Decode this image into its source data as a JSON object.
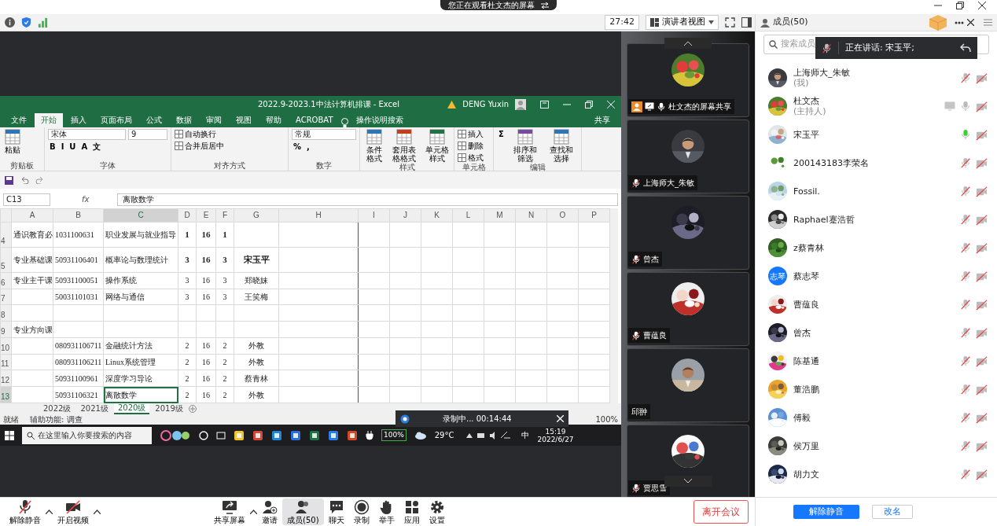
{
  "banner": {
    "text": "您正在观看杜文杰的屏幕"
  },
  "toolbar": {
    "timer": "27:42",
    "view": "演讲者视图"
  },
  "shared_screen": {
    "excel": {
      "title": "2022.9-2023.1中法计算机排课  -  Excel",
      "user": "DENG Yuxin",
      "tabs": [
        {
          "label": "文件",
          "selected": false
        },
        {
          "label": "开始",
          "selected": true
        },
        {
          "label": "插入",
          "selected": false
        },
        {
          "label": "页面布局",
          "selected": false
        },
        {
          "label": "公式",
          "selected": false
        },
        {
          "label": "数据",
          "selected": false
        },
        {
          "label": "审阅",
          "selected": false
        },
        {
          "label": "视图",
          "selected": false
        },
        {
          "label": "帮助",
          "selected": false
        },
        {
          "label": "ACROBAT",
          "selected": false
        }
      ],
      "tell_me": "操作说明搜索",
      "share": "共享",
      "ribbon": [
        {
          "label": "剪贴板",
          "items": [
            {
              "kind": "big",
              "label": "粘贴"
            }
          ]
        },
        {
          "label": "字体",
          "items": [
            {
              "kind": "stack",
              "lines": [
                [
                  {
                    "kind": "field",
                    "value": "宋体"
                  },
                  {
                    "kind": "field",
                    "value": "9"
                  }
                ],
                [
                  {
                    "kind": "glyph",
                    "label": "B"
                  },
                  {
                    "kind": "glyph",
                    "label": "I"
                  },
                  {
                    "kind": "glyph",
                    "label": "U"
                  },
                  {
                    "kind": "glyph",
                    "label": "A"
                  },
                  {
                    "kind": "glyph",
                    "label": "文"
                  }
                ]
              ]
            }
          ]
        },
        {
          "label": "对齐方式",
          "items": [
            {
              "kind": "stack",
              "lines": [
                [
                  {
                    "kind": "small",
                    "label": "自动换行"
                  }
                ],
                [
                  {
                    "kind": "small",
                    "label": "合并后居中"
                  }
                ]
              ]
            }
          ]
        },
        {
          "label": "数字",
          "items": [
            {
              "kind": "stack",
              "lines": [
                [
                  {
                    "kind": "field",
                    "value": "常规"
                  }
                ],
                [
                  {
                    "kind": "glyph",
                    "label": "%"
                  },
                  {
                    "kind": "glyph",
                    "label": ","
                  }
                ]
              ]
            }
          ]
        },
        {
          "label": "样式",
          "items": [
            {
              "kind": "big",
              "label": "条件格式"
            },
            {
              "kind": "big",
              "label": "套用表格格式"
            },
            {
              "kind": "big",
              "label": "单元格样式"
            }
          ]
        },
        {
          "label": "单元格",
          "items": [
            {
              "kind": "stack",
              "lines": [
                [
                  {
                    "kind": "small",
                    "label": "插入"
                  }
                ],
                [
                  {
                    "kind": "small",
                    "label": "删除"
                  }
                ],
                [
                  {
                    "kind": "small",
                    "label": "格式"
                  }
                ]
              ]
            }
          ]
        },
        {
          "label": "编辑",
          "items": [
            {
              "kind": "stack",
              "lines": [
                [
                  {
                    "kind": "glyph",
                    "label": "Σ"
                  }
                ]
              ]
            },
            {
              "kind": "big",
              "label": "排序和筛选"
            },
            {
              "kind": "big",
              "label": "查找和选择"
            }
          ]
        }
      ],
      "name_box": "C13",
      "fx": "fx",
      "formula": "离散数学",
      "columns": [
        {
          "label": "A",
          "selected": false
        },
        {
          "label": "B",
          "selected": false
        },
        {
          "label": "C",
          "selected": true
        },
        {
          "label": "D",
          "selected": false
        },
        {
          "label": "E",
          "selected": false
        },
        {
          "label": "F",
          "selected": false
        },
        {
          "label": "G",
          "selected": false
        },
        {
          "label": "H",
          "selected": false
        },
        {
          "label": "I",
          "selected": false
        },
        {
          "label": "J",
          "selected": false
        },
        {
          "label": "K",
          "selected": false
        },
        {
          "label": "L",
          "selected": false
        },
        {
          "label": "M",
          "selected": false
        },
        {
          "label": "N",
          "selected": false
        },
        {
          "label": "O",
          "selected": false
        },
        {
          "label": "P",
          "selected": false
        }
      ],
      "rows": [
        {
          "number": "4",
          "bold": true,
          "selected": false,
          "cells": [
            "通识教育必",
            "1031100631",
            "职业发展与就业指导",
            "1",
            "16",
            "1",
            "",
            ""
          ]
        },
        {
          "number": "5",
          "bold": true,
          "selected": false,
          "cells": [
            "专业基础课",
            "50931106401",
            "概率论与数理统计",
            "3",
            "16",
            "3",
            "宋玉平",
            ""
          ]
        },
        {
          "number": "6",
          "bold": false,
          "selected": false,
          "cells": [
            "专业主干课",
            "50931100051",
            "操作系统",
            "3",
            "16",
            "3",
            "郑晓妹",
            ""
          ]
        },
        {
          "number": "7",
          "bold": false,
          "selected": false,
          "cells": [
            "",
            "50031101031",
            "网络与通信",
            "3",
            "16",
            "3",
            "王笑梅",
            ""
          ]
        },
        {
          "number": "8",
          "bold": false,
          "selected": false,
          "cells": [
            "",
            "",
            "",
            "",
            "",
            "",
            "",
            ""
          ]
        },
        {
          "number": "9",
          "bold": false,
          "selected": false,
          "cells": [
            "专业方向课",
            "",
            "",
            "",
            "",
            "",
            "",
            ""
          ]
        },
        {
          "number": "10",
          "bold": false,
          "selected": false,
          "cells": [
            "",
            "080931106711",
            "金融统计方法",
            "2",
            "16",
            "2",
            "外教",
            ""
          ]
        },
        {
          "number": "11",
          "bold": false,
          "selected": false,
          "cells": [
            "",
            "080931106211",
            "Linux系统管理",
            "2",
            "16",
            "2",
            "外教",
            ""
          ]
        },
        {
          "number": "12",
          "bold": false,
          "selected": false,
          "cells": [
            "",
            "50931100961",
            "深度学习导论",
            "2",
            "16",
            "2",
            "蔡青林",
            ""
          ]
        },
        {
          "number": "13",
          "bold": false,
          "selected": true,
          "cells": [
            "",
            "50931106321",
            "离散数学",
            "2",
            "16",
            "2",
            "外教",
            ""
          ]
        }
      ],
      "sheets": [
        {
          "label": "2022级",
          "selected": false
        },
        {
          "label": "2021级",
          "selected": false
        },
        {
          "label": "2020级",
          "selected": true
        },
        {
          "label": "2019级",
          "selected": false
        }
      ],
      "status": "就绪",
      "accessibility": "辅助功能: 调查",
      "zoom": "100%"
    },
    "taskbar": {
      "search_placeholder": "在这里输入你要搜索的内容",
      "battery": "100%",
      "weather": "29°C",
      "ime": "中",
      "time": "15:19",
      "date": "2022/6/27"
    },
    "recording": {
      "text": "录制中... 00:14:44"
    }
  },
  "video_tiles": [
    {
      "name": "杜文杰的屏幕共享",
      "kind": "share",
      "muted": false
    },
    {
      "name": "上海师大_朱敏",
      "kind": "person",
      "muted": true
    },
    {
      "name": "曾杰",
      "kind": "person",
      "muted": true
    },
    {
      "name": "曹蕴良",
      "kind": "person",
      "muted": true
    },
    {
      "name": "邱翀",
      "kind": "person"
    },
    {
      "name": "贾思雪",
      "kind": "person",
      "muted": true
    }
  ],
  "members_panel": {
    "title": "成员(50)",
    "search_placeholder": "搜索成员",
    "speaking": "正在讲话: 宋玉平;",
    "members": [
      {
        "name": "上海师大_朱敏",
        "note": "(我)",
        "sharing": false,
        "muted": true,
        "speaking": false,
        "camera_on": false
      },
      {
        "name": "杜文杰",
        "note": "(主持人)",
        "sharing": true,
        "muted": false,
        "speaking": false,
        "camera_on": false
      },
      {
        "name": "宋玉平",
        "sharing": false,
        "muted": false,
        "speaking": true,
        "camera_on": false
      },
      {
        "name": "200143183李荣名",
        "sharing": false,
        "muted": true,
        "speaking": false,
        "camera_on": false
      },
      {
        "name": "Fossil.",
        "sharing": false,
        "muted": true,
        "speaking": false,
        "camera_on": false
      },
      {
        "name": "Raphael蹇浩哲",
        "sharing": false,
        "muted": true,
        "speaking": false,
        "camera_on": false
      },
      {
        "name": "z蔡青林",
        "sharing": false,
        "muted": true,
        "speaking": false,
        "camera_on": false
      },
      {
        "name": "蔡志琴",
        "avatar": {
          "kind": "text",
          "text": "志琴"
        },
        "sharing": false,
        "muted": true,
        "speaking": false,
        "camera_on": false
      },
      {
        "name": "曹蕴良",
        "sharing": false,
        "muted": true,
        "speaking": false,
        "camera_on": false
      },
      {
        "name": "曾杰",
        "sharing": false,
        "muted": true,
        "speaking": false,
        "camera_on": false
      },
      {
        "name": "陈基通",
        "sharing": false,
        "muted": true,
        "speaking": false,
        "camera_on": false
      },
      {
        "name": "董浩鹏",
        "sharing": false,
        "muted": true,
        "speaking": false,
        "camera_on": false
      },
      {
        "name": "傅毅",
        "sharing": false,
        "muted": true,
        "speaking": false,
        "camera_on": false
      },
      {
        "name": "侯万里",
        "sharing": false,
        "muted": true,
        "speaking": false,
        "camera_on": false
      },
      {
        "name": "胡力文",
        "sharing": false,
        "muted": true,
        "speaking": false,
        "camera_on": false
      }
    ],
    "buttons": [
      {
        "label": "解除静音",
        "kind": "primary"
      },
      {
        "label": "改名",
        "kind": "outline"
      }
    ]
  },
  "bottom_toolbar": {
    "items": [
      {
        "label": "解除静音",
        "kind": "mic",
        "has_menu": true,
        "selected": false
      },
      {
        "label": "开启视频",
        "kind": "video",
        "has_menu": true,
        "selected": false
      },
      {
        "label": "共享屏幕",
        "kind": "share",
        "has_menu": true,
        "selected": false
      },
      {
        "label": "邀请",
        "kind": "invite",
        "has_menu": false,
        "selected": false
      },
      {
        "label": "成员(50)",
        "kind": "members",
        "has_menu": false,
        "selected": true
      },
      {
        "label": "聊天",
        "kind": "chat",
        "has_menu": false,
        "selected": false
      },
      {
        "label": "录制",
        "kind": "record",
        "has_menu": false,
        "selected": false
      },
      {
        "label": "举手",
        "kind": "hand",
        "has_menu": false,
        "selected": false
      },
      {
        "label": "应用",
        "kind": "apps",
        "has_menu": false,
        "selected": false
      },
      {
        "label": "设置",
        "kind": "settings",
        "has_menu": false,
        "selected": false
      }
    ],
    "leave": "离开会议"
  }
}
